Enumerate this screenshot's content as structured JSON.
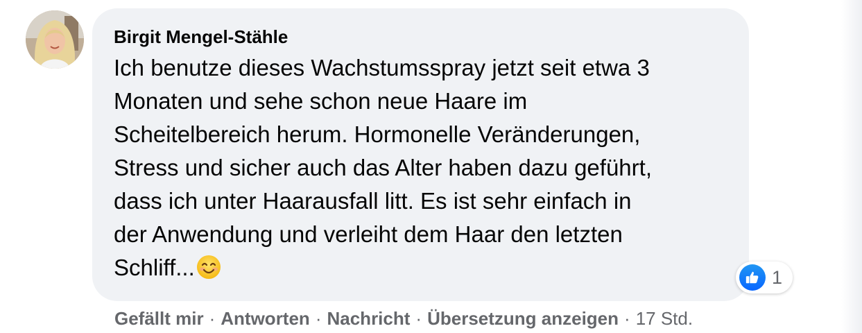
{
  "comment": {
    "author": "Birgit Mengel-Stähle",
    "text_lines": [
      "Ich benutze dieses Wachstumsspray jetzt seit etwa 3",
      "Monaten und sehe schon neue Haare im",
      "Scheitelbereich herum. Hormonelle Veränderungen,",
      "Stress und sicher auch das Alter haben dazu geführt,",
      "dass ich unter Haarausfall litt. Es ist sehr einfach in",
      "der Anwendung und verleiht dem Haar den letzten",
      "Schliff..."
    ],
    "emoji": "smiling-face-icon",
    "reactions": {
      "icon": "thumbs-up-icon",
      "count": "1"
    }
  },
  "actions": {
    "like_label": "Gefällt mir",
    "reply_label": "Antworten",
    "message_label": "Nachricht",
    "translate_label": "Übersetzung anzeigen",
    "separator": "·",
    "timestamp": "17 Std."
  },
  "colors": {
    "bubble": "#f0f2f5",
    "text": "#050505",
    "secondary_text": "#65676b",
    "like_blue": "#0866ff"
  }
}
